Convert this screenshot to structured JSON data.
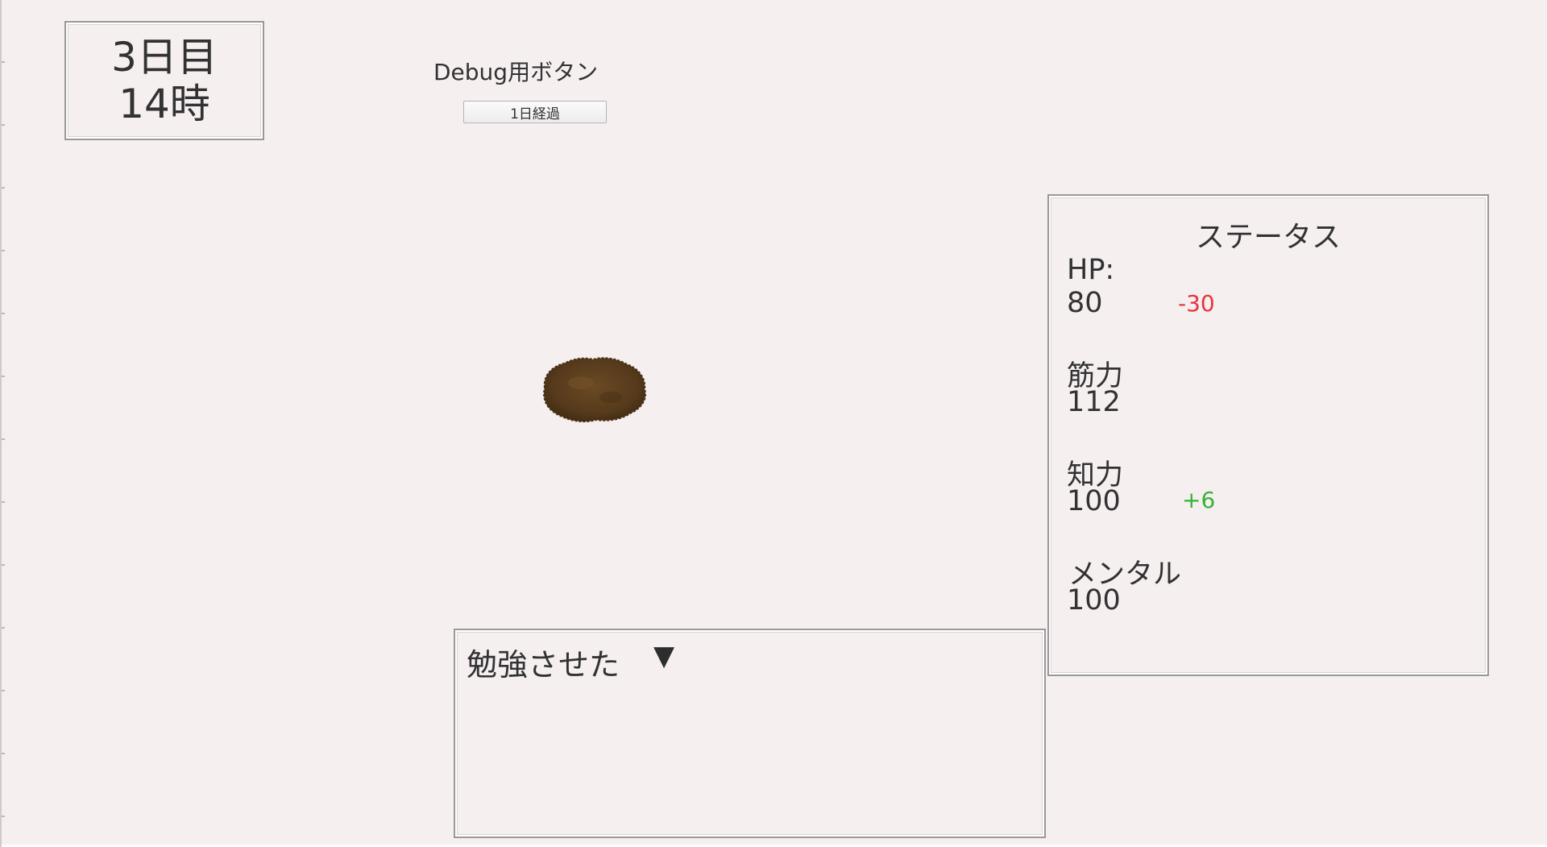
{
  "day_box": {
    "day": "3日目",
    "time": "14時"
  },
  "debug": {
    "label": "Debug用ボタン",
    "button_label": "1日経過"
  },
  "status": {
    "title": "ステータス",
    "hp_label": "HP:",
    "hp_value": "80",
    "hp_delta": "-30",
    "strength_label": "筋力",
    "strength_value": "112",
    "intelligence_label": "知力",
    "intelligence_value": "100",
    "intelligence_delta": "+6",
    "mental_label": "メンタル",
    "mental_value": "100"
  },
  "message": {
    "text": "勉強させた",
    "arrow": "▼"
  },
  "colors": {
    "background": "#f5eff0",
    "panel_border": "#9b9798",
    "text": "#323232",
    "delta_negative": "#e8343c",
    "delta_positive": "#36b236",
    "character": "#5a3d1c"
  },
  "icons": {
    "character": "brown-blob-character",
    "advance": "down-triangle-icon"
  }
}
